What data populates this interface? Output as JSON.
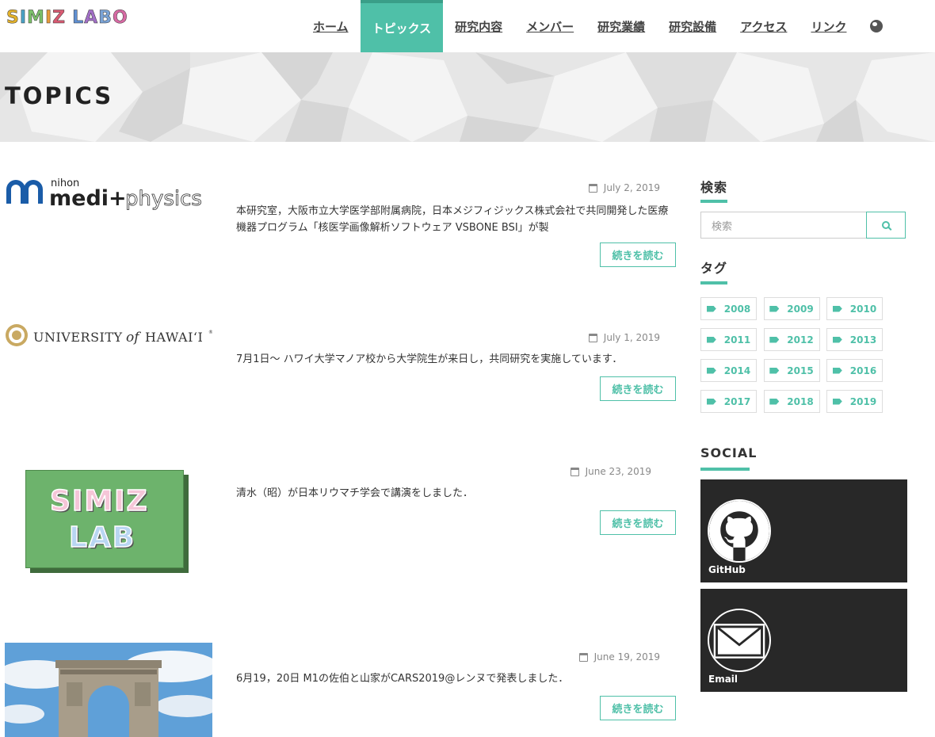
{
  "header": {
    "logo_letters": [
      "S",
      "I",
      "M",
      "I",
      "Z",
      " ",
      "L",
      "A",
      "B",
      "O"
    ],
    "logo_colors": [
      "#e2b12c",
      "#4aa3c7",
      "#7cc16a",
      "#e89b3a",
      "#d95b73",
      "#ffffff",
      "#5f8fd1",
      "#a26fc7",
      "#7aa3d6",
      "#d66aa3"
    ],
    "nav": [
      "ホーム",
      "トピックス",
      "研究内容",
      "メンバー",
      "研究業績",
      "研究設備",
      "アクセス",
      "リンク"
    ],
    "active_index": 1
  },
  "banner": {
    "title": "TOPICS"
  },
  "posts": [
    {
      "date": "July 2, 2019",
      "text": "本研究室，大阪市立大学医学部附属病院，日本メジフィジックス株式会社で共同開発した医療機器プログラム「核医学画像解析ソフトウェア VSBONE BSI」が製",
      "read_more": "続きを読む",
      "thumb": {
        "brand_small": "nihon",
        "brand_a": "medi+",
        "brand_b": "physics"
      }
    },
    {
      "date": "July 1, 2019",
      "text": "7月1日〜 ハワイ大学マノア校から大学院生が来日し，共同研究を実施しています．",
      "read_more": "続きを読む",
      "thumb": {
        "brand_a": "UNIVERSITY",
        "brand_of": "of",
        "brand_b": "HAWAI‘I",
        "mark": "®"
      }
    },
    {
      "date": "June 23, 2019",
      "text": "清水（昭）が日本リウマチ学会で講演をしました．",
      "read_more": "続きを読む",
      "thumb": {
        "line1": "SIMIZ",
        "line2": "LAB"
      }
    },
    {
      "date": "June 19, 2019",
      "text": "6月19，20日 M1の佐伯と山家がCARS2019@レンヌで発表しました．",
      "read_more": "続きを読む",
      "thumb": {}
    }
  ],
  "sidebar": {
    "search_heading": "検索",
    "search_placeholder": "検索",
    "tags_heading": "タグ",
    "tags": [
      "2008",
      "2009",
      "2010",
      "2011",
      "2012",
      "2013",
      "2014",
      "2015",
      "2016",
      "2017",
      "2018",
      "2019"
    ],
    "social_heading": "SOCIAL",
    "social": [
      {
        "label": "GitHub",
        "icon": "github-icon"
      },
      {
        "label": "Email",
        "icon": "email-icon"
      }
    ]
  },
  "colors": {
    "accent": "#4fc0a8",
    "dark": "#282828"
  }
}
